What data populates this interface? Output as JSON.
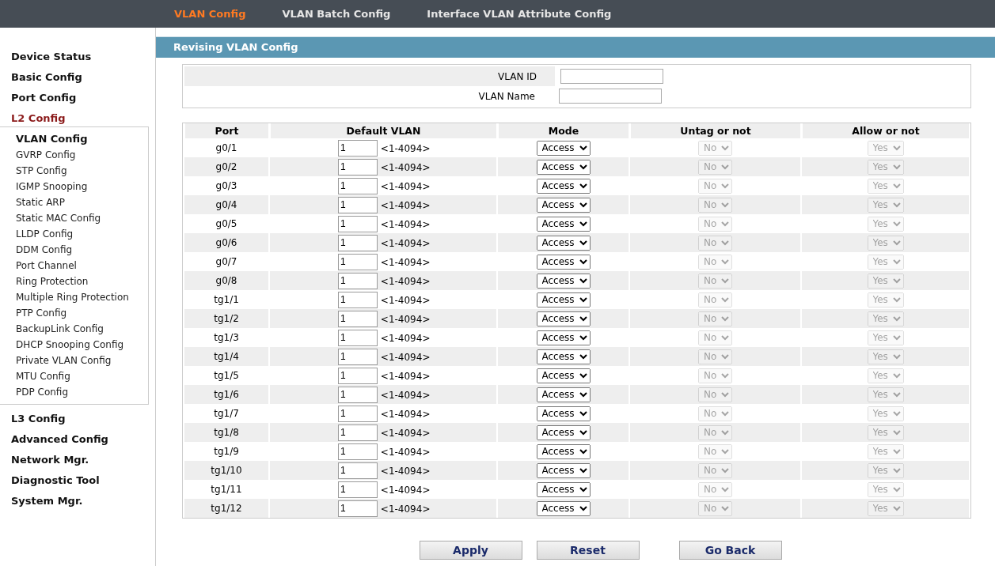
{
  "top_tabs": [
    {
      "label": "VLAN Config",
      "selected": true
    },
    {
      "label": "VLAN Batch Config",
      "selected": false
    },
    {
      "label": "Interface VLAN Attribute Config",
      "selected": false
    }
  ],
  "sidebar": {
    "items": [
      {
        "label": "Device Status",
        "selected": false
      },
      {
        "label": "Basic Config",
        "selected": false
      },
      {
        "label": "Port Config",
        "selected": false
      },
      {
        "label": "L2 Config",
        "selected": true,
        "children": [
          {
            "label": "VLAN Config",
            "selected": true
          },
          {
            "label": "GVRP Config",
            "selected": false
          },
          {
            "label": "STP Config",
            "selected": false
          },
          {
            "label": "IGMP Snooping",
            "selected": false
          },
          {
            "label": "Static ARP",
            "selected": false
          },
          {
            "label": "Static MAC Config",
            "selected": false
          },
          {
            "label": "LLDP Config",
            "selected": false
          },
          {
            "label": "DDM Config",
            "selected": false
          },
          {
            "label": "Port Channel",
            "selected": false
          },
          {
            "label": "Ring Protection",
            "selected": false
          },
          {
            "label": "Multiple Ring Protection",
            "selected": false
          },
          {
            "label": "PTP Config",
            "selected": false
          },
          {
            "label": "BackupLink Config",
            "selected": false
          },
          {
            "label": "DHCP Snooping Config",
            "selected": false
          },
          {
            "label": "Private VLAN Config",
            "selected": false
          },
          {
            "label": "MTU Config",
            "selected": false
          },
          {
            "label": "PDP Config",
            "selected": false
          }
        ]
      },
      {
        "label": "L3 Config",
        "selected": false
      },
      {
        "label": "Advanced Config",
        "selected": false
      },
      {
        "label": "Network Mgr.",
        "selected": false
      },
      {
        "label": "Diagnostic Tool",
        "selected": false
      },
      {
        "label": "System Mgr.",
        "selected": false
      }
    ]
  },
  "section_title": "Revising VLAN Config",
  "form": [
    {
      "label": "VLAN ID"
    },
    {
      "label": "VLAN Name"
    }
  ],
  "table": {
    "columns": [
      "Port",
      "Default VLAN",
      "Mode",
      "Untag or not",
      "Allow or not"
    ],
    "rows": [
      {
        "port": "g0/1",
        "default_vlan": "1",
        "range": "<1-4094>",
        "mode": "Access",
        "untag": "No",
        "untag_disabled": true,
        "allow": "Yes",
        "allow_disabled": true
      },
      {
        "port": "g0/2",
        "default_vlan": "1",
        "range": "<1-4094>",
        "mode": "Access",
        "untag": "No",
        "untag_disabled": true,
        "allow": "Yes",
        "allow_disabled": true
      },
      {
        "port": "g0/3",
        "default_vlan": "1",
        "range": "<1-4094>",
        "mode": "Access",
        "untag": "No",
        "untag_disabled": true,
        "allow": "Yes",
        "allow_disabled": true
      },
      {
        "port": "g0/4",
        "default_vlan": "1",
        "range": "<1-4094>",
        "mode": "Access",
        "untag": "No",
        "untag_disabled": true,
        "allow": "Yes",
        "allow_disabled": true
      },
      {
        "port": "g0/5",
        "default_vlan": "1",
        "range": "<1-4094>",
        "mode": "Access",
        "untag": "No",
        "untag_disabled": true,
        "allow": "Yes",
        "allow_disabled": true
      },
      {
        "port": "g0/6",
        "default_vlan": "1",
        "range": "<1-4094>",
        "mode": "Access",
        "untag": "No",
        "untag_disabled": true,
        "allow": "Yes",
        "allow_disabled": true
      },
      {
        "port": "g0/7",
        "default_vlan": "1",
        "range": "<1-4094>",
        "mode": "Access",
        "untag": "No",
        "untag_disabled": true,
        "allow": "Yes",
        "allow_disabled": true
      },
      {
        "port": "g0/8",
        "default_vlan": "1",
        "range": "<1-4094>",
        "mode": "Access",
        "untag": "No",
        "untag_disabled": true,
        "allow": "Yes",
        "allow_disabled": true
      },
      {
        "port": "tg1/1",
        "default_vlan": "1",
        "range": "<1-4094>",
        "mode": "Access",
        "untag": "No",
        "untag_disabled": true,
        "allow": "Yes",
        "allow_disabled": true
      },
      {
        "port": "tg1/2",
        "default_vlan": "1",
        "range": "<1-4094>",
        "mode": "Access",
        "untag": "No",
        "untag_disabled": true,
        "allow": "Yes",
        "allow_disabled": true
      },
      {
        "port": "tg1/3",
        "default_vlan": "1",
        "range": "<1-4094>",
        "mode": "Access",
        "untag": "No",
        "untag_disabled": true,
        "allow": "Yes",
        "allow_disabled": true
      },
      {
        "port": "tg1/4",
        "default_vlan": "1",
        "range": "<1-4094>",
        "mode": "Access",
        "untag": "No",
        "untag_disabled": true,
        "allow": "Yes",
        "allow_disabled": true
      },
      {
        "port": "tg1/5",
        "default_vlan": "1",
        "range": "<1-4094>",
        "mode": "Access",
        "untag": "No",
        "untag_disabled": true,
        "allow": "Yes",
        "allow_disabled": true
      },
      {
        "port": "tg1/6",
        "default_vlan": "1",
        "range": "<1-4094>",
        "mode": "Access",
        "untag": "No",
        "untag_disabled": true,
        "allow": "Yes",
        "allow_disabled": true
      },
      {
        "port": "tg1/7",
        "default_vlan": "1",
        "range": "<1-4094>",
        "mode": "Access",
        "untag": "No",
        "untag_disabled": true,
        "allow": "Yes",
        "allow_disabled": true
      },
      {
        "port": "tg1/8",
        "default_vlan": "1",
        "range": "<1-4094>",
        "mode": "Access",
        "untag": "No",
        "untag_disabled": true,
        "allow": "Yes",
        "allow_disabled": true
      },
      {
        "port": "tg1/9",
        "default_vlan": "1",
        "range": "<1-4094>",
        "mode": "Access",
        "untag": "No",
        "untag_disabled": true,
        "allow": "Yes",
        "allow_disabled": true
      },
      {
        "port": "tg1/10",
        "default_vlan": "1",
        "range": "<1-4094>",
        "mode": "Access",
        "untag": "No",
        "untag_disabled": true,
        "allow": "Yes",
        "allow_disabled": true
      },
      {
        "port": "tg1/11",
        "default_vlan": "1",
        "range": "<1-4094>",
        "mode": "Access",
        "untag": "No",
        "untag_disabled": true,
        "allow": "Yes",
        "allow_disabled": true
      },
      {
        "port": "tg1/12",
        "default_vlan": "1",
        "range": "<1-4094>",
        "mode": "Access",
        "untag": "No",
        "untag_disabled": true,
        "allow": "Yes",
        "allow_disabled": true
      }
    ]
  },
  "buttons": [
    "Apply",
    "Reset",
    "Go Back"
  ]
}
